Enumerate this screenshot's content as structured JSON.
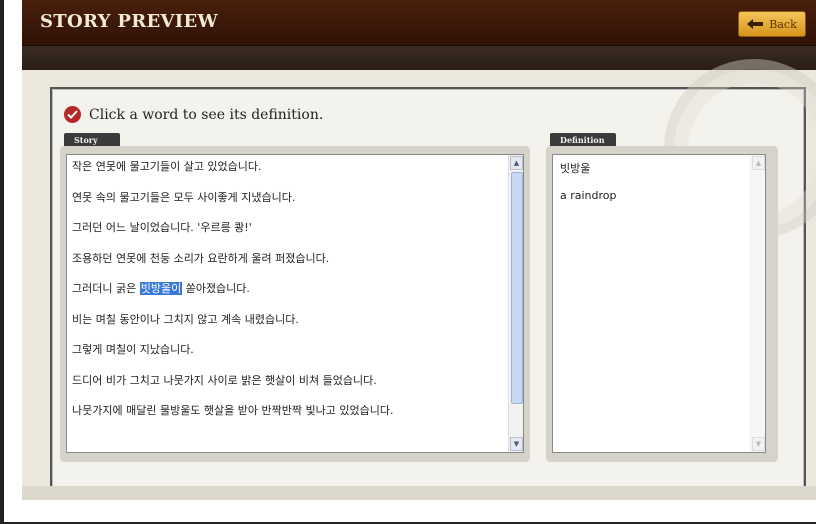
{
  "header": {
    "title": "STORY PREVIEW",
    "back_label": "Back"
  },
  "instruction": "Click a word to see its definition.",
  "story_panel": {
    "tab_label": "Story",
    "lines": [
      "작은 연못에 물고기들이 살고 있었습니다.",
      "연못 속의 물고기들은 모두 사이좋게 지냈습니다.",
      "그러던 어느 날이었습니다. '우르릉 쾅!'",
      "조용하던 연못에 천둥 소리가 요란하게 울려 퍼졌습니다.",
      "비는 며칠 동안이나 그치지 않고 계속 내렸습니다.",
      "그렇게 며칠이 지났습니다.",
      "드디어 비가 그치고 나뭇가지 사이로 밝은 햇살이 비쳐 들었습니다.",
      "나뭇가지에 매달린 물방울도 햇살을 받아 반짝반짝 빛나고 있었습니다."
    ],
    "highlight_line": {
      "before": "그러더니 굵은 ",
      "selected_word": "빗방울이",
      "after": " 쏟아졌습니다."
    }
  },
  "definition_panel": {
    "tab_label": "Definition",
    "word": "빗방울",
    "meaning": "a raindrop"
  },
  "colors": {
    "header_bg": "#3b170a",
    "back_button": "#e7a933",
    "highlight": "#3a78d8",
    "check_icon": "#b52828"
  },
  "icons": [
    "back-arrow-icon",
    "check-circle-icon",
    "scroll-up-icon",
    "scroll-down-icon"
  ]
}
